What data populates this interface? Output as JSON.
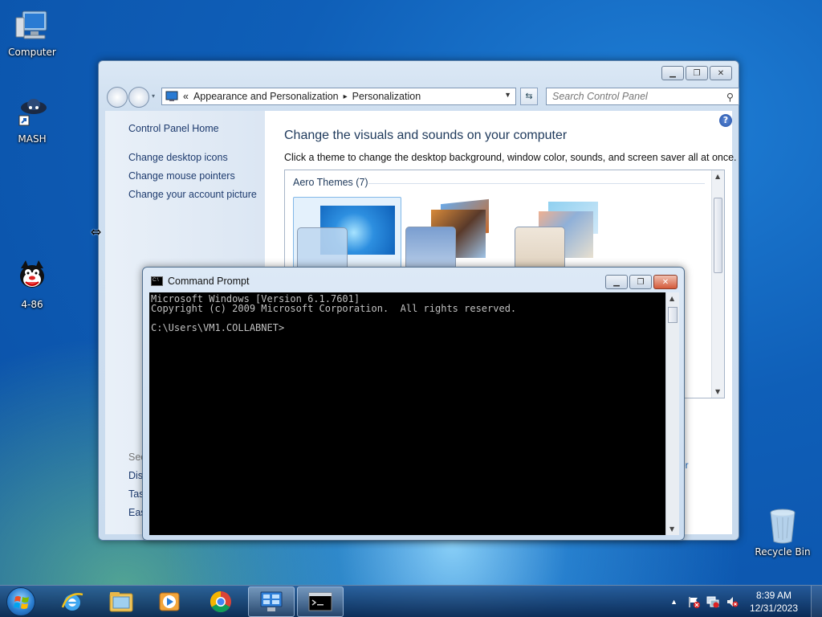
{
  "desktop": {
    "icons": [
      {
        "label": "Computer",
        "icon": "computer-icon"
      },
      {
        "label": "MASH",
        "icon": "mash-shortcut-icon"
      },
      {
        "label": "4-86",
        "icon": "cartoon-cat-icon"
      },
      {
        "label": "Recycle Bin",
        "icon": "recycle-bin-icon"
      }
    ]
  },
  "control_panel": {
    "address": {
      "chevrons": "«",
      "crumb1": "Appearance and Personalization",
      "separator": "▸",
      "crumb2": "Personalization"
    },
    "search_placeholder": "Search Control Panel",
    "sidebar": {
      "home": "Control Panel Home",
      "links": [
        "Change desktop icons",
        "Change mouse pointers",
        "Change your account picture"
      ],
      "see_also": [
        "See",
        "Disp",
        "Tas",
        "Eas"
      ]
    },
    "heading": "Change the visuals and sounds on your computer",
    "subheading": "Click a theme to change the desktop background, window color, sounds, and screen saver all at once.",
    "theme_group": "Aero Themes (7)",
    "partial_link": "yer"
  },
  "cmd": {
    "title": "Command Prompt",
    "icon_text": "C:\\",
    "lines": [
      "Microsoft Windows [Version 6.1.7601]",
      "Copyright (c) 2009 Microsoft Corporation.  All rights reserved.",
      "",
      "C:\\Users\\VM1.COLLABNET>"
    ]
  },
  "taskbar": {
    "items": [
      "internet-explorer-icon",
      "windows-explorer-icon",
      "media-player-icon",
      "chrome-icon",
      "control-panel-icon",
      "command-prompt-icon"
    ],
    "time": "8:39 AM",
    "date": "12/31/2023"
  },
  "colors": {
    "link": "#1e3b6e",
    "heading": "#1e395b",
    "console_text": "#c0c0c0"
  }
}
